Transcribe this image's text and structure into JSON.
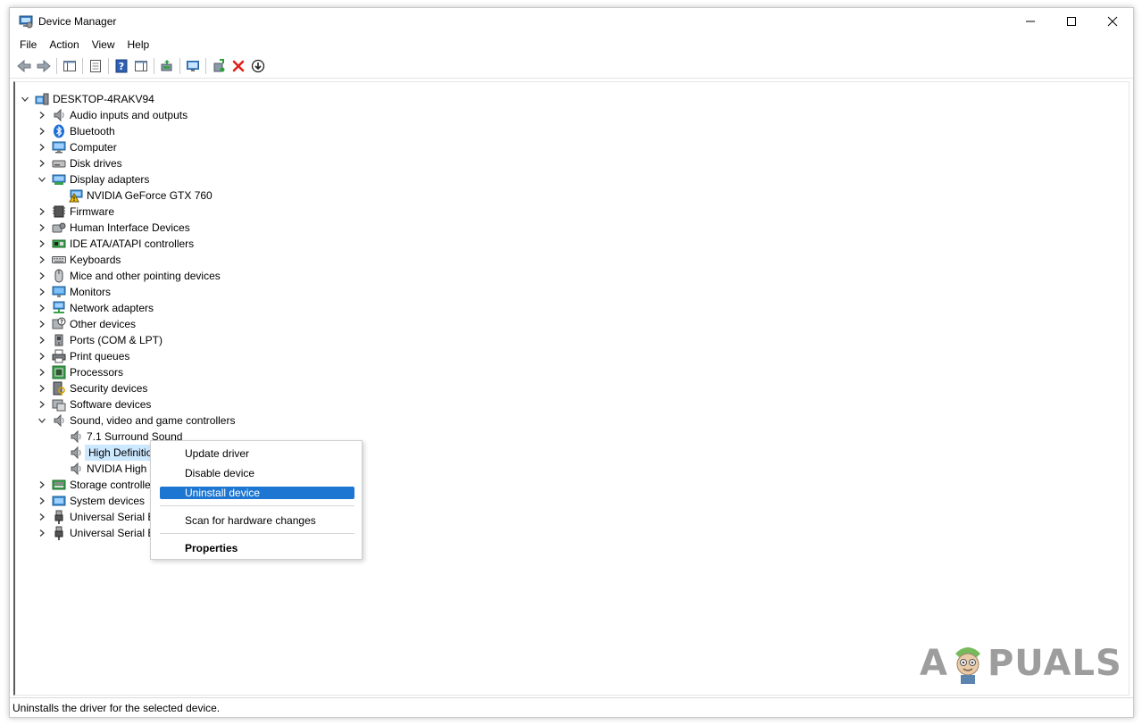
{
  "window": {
    "title": "Device Manager"
  },
  "menu": [
    "File",
    "Action",
    "View",
    "Help"
  ],
  "toolbar": [
    "back-arrow-icon",
    "forward-arrow-icon",
    "console-tree-icon",
    "properties-icon",
    "help-icon",
    "action-pane-icon",
    "update-driver-icon",
    "scan-hardware-icon",
    "add-legacy-icon",
    "uninstall-icon",
    "download-icon"
  ],
  "tree": {
    "root": "DESKTOP-4RAKV94",
    "categories": [
      {
        "label": "Audio inputs and outputs",
        "icon": "speaker-icon",
        "expanded": false
      },
      {
        "label": "Bluetooth",
        "icon": "bluetooth-icon",
        "expanded": false
      },
      {
        "label": "Computer",
        "icon": "computer-icon",
        "expanded": false
      },
      {
        "label": "Disk drives",
        "icon": "disk-icon",
        "expanded": false
      },
      {
        "label": "Display adapters",
        "icon": "display-adapter-icon",
        "expanded": true,
        "children": [
          {
            "label": "NVIDIA GeForce GTX 760",
            "icon": "display-adapter-warning-icon"
          }
        ]
      },
      {
        "label": "Firmware",
        "icon": "firmware-icon",
        "expanded": false
      },
      {
        "label": "Human Interface Devices",
        "icon": "hid-icon",
        "expanded": false
      },
      {
        "label": "IDE ATA/ATAPI controllers",
        "icon": "ide-icon",
        "expanded": false
      },
      {
        "label": "Keyboards",
        "icon": "keyboard-icon",
        "expanded": false
      },
      {
        "label": "Mice and other pointing devices",
        "icon": "mouse-icon",
        "expanded": false
      },
      {
        "label": "Monitors",
        "icon": "monitor-icon",
        "expanded": false
      },
      {
        "label": "Network adapters",
        "icon": "network-icon",
        "expanded": false
      },
      {
        "label": "Other devices",
        "icon": "other-device-icon",
        "expanded": false
      },
      {
        "label": "Ports (COM & LPT)",
        "icon": "port-icon",
        "expanded": false
      },
      {
        "label": "Print queues",
        "icon": "printer-icon",
        "expanded": false
      },
      {
        "label": "Processors",
        "icon": "processor-icon",
        "expanded": false
      },
      {
        "label": "Security devices",
        "icon": "security-icon",
        "expanded": false
      },
      {
        "label": "Software devices",
        "icon": "software-icon",
        "expanded": false
      },
      {
        "label": "Sound, video and game controllers",
        "icon": "speaker-icon",
        "expanded": true,
        "children": [
          {
            "label": "7.1 Surround Sound",
            "icon": "speaker-icon"
          },
          {
            "label": "High Definitio",
            "icon": "speaker-icon",
            "selected": true
          },
          {
            "label": "NVIDIA High D",
            "icon": "speaker-icon"
          }
        ]
      },
      {
        "label": "Storage controlle",
        "icon": "storage-icon",
        "expanded": false
      },
      {
        "label": "System devices",
        "icon": "system-icon",
        "expanded": false
      },
      {
        "label": "Universal Serial Bu",
        "icon": "usb-icon",
        "expanded": false
      },
      {
        "label": "Universal Serial Bu",
        "icon": "usb-icon",
        "expanded": false
      }
    ]
  },
  "context_menu": {
    "update": "Update driver",
    "disable": "Disable device",
    "uninstall": "Uninstall device",
    "scan": "Scan for hardware changes",
    "properties": "Properties"
  },
  "status": "Uninstalls the driver for the selected device.",
  "watermark": {
    "left": "A",
    "right": "PUALS"
  },
  "colors": {
    "highlight": "#1c76d2",
    "selection": "#cce8ff",
    "warning": "#f2c200",
    "delete": "#e0201a"
  }
}
